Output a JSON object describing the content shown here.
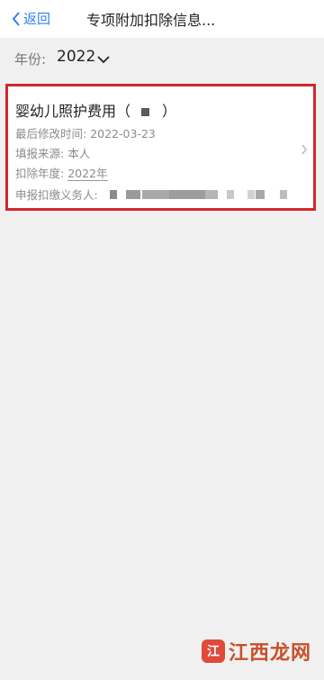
{
  "nav": {
    "back_label": "返回",
    "title": "专项附加扣除信息..."
  },
  "filter": {
    "year_label": "年份:",
    "year_value": "2022"
  },
  "record": {
    "title_prefix": "婴幼儿照护费用（",
    "title_suffix": "）",
    "modified_label": "最后修改时间:",
    "modified_value": "2022-03-23",
    "source_label": "填报来源:",
    "source_value": "本人",
    "deduction_year_label": "扣除年度:",
    "deduction_year_value": "2022年",
    "withholding_agent_label": "申报扣缴义务人:"
  },
  "watermark": {
    "logo_char": "江",
    "text": "江西龙网"
  },
  "colors": {
    "accent": "#2f7ff0",
    "highlight_border": "#d0282c",
    "background": "#f0f0f0"
  }
}
